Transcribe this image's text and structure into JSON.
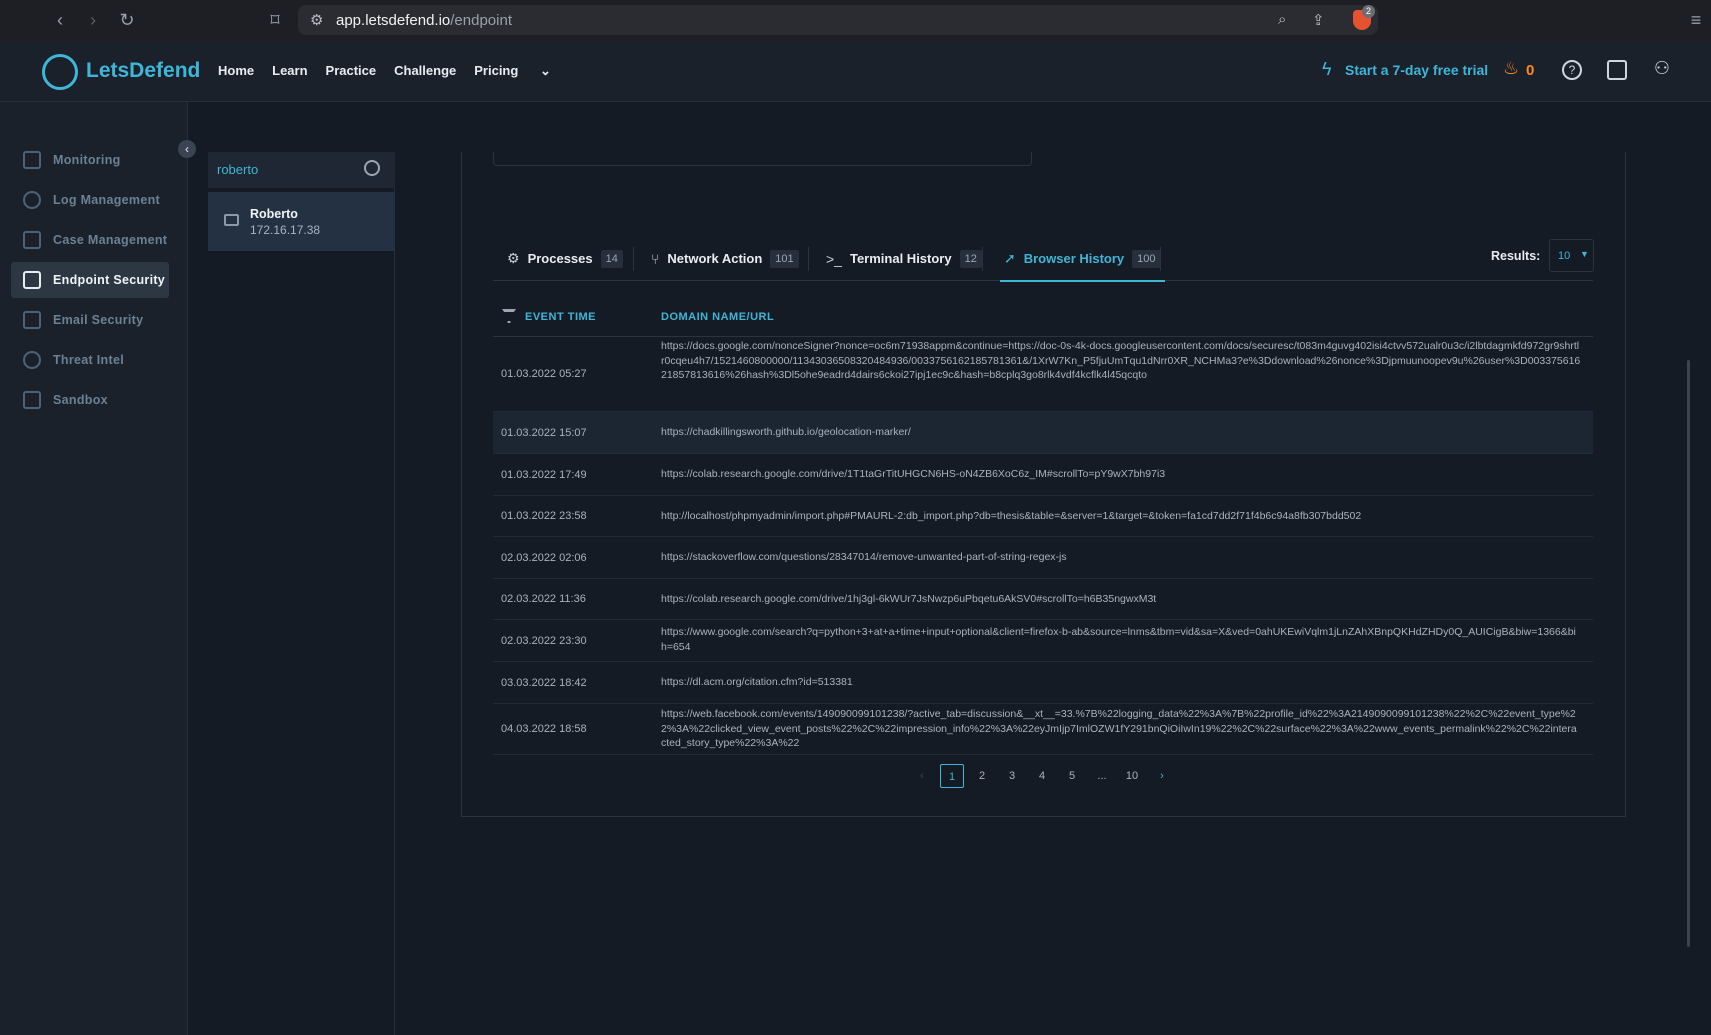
{
  "browser": {
    "url_host": "app.letsdefend.io",
    "url_path": "/endpoint",
    "extension_badge": "2"
  },
  "header": {
    "logo_text": "LetsDefend",
    "nav": [
      "Home",
      "Learn",
      "Practice",
      "Challenge",
      "Pricing"
    ],
    "trial_label": "Start a 7-day free trial",
    "streak_count": "0"
  },
  "sidebar": {
    "items": [
      {
        "label": "Monitoring"
      },
      {
        "label": "Log Management"
      },
      {
        "label": "Case Management"
      },
      {
        "label": "Endpoint Security"
      },
      {
        "label": "Email Security"
      },
      {
        "label": "Threat Intel"
      },
      {
        "label": "Sandbox"
      }
    ],
    "active_index": 3
  },
  "endpoints": {
    "search_value": "roberto",
    "items": [
      {
        "name": "Roberto",
        "ip": "172.16.17.38"
      }
    ]
  },
  "tabs": [
    {
      "label": "Processes",
      "count": "14"
    },
    {
      "label": "Network Action",
      "count": "101"
    },
    {
      "label": "Terminal History",
      "count": "12"
    },
    {
      "label": "Browser History",
      "count": "100"
    }
  ],
  "active_tab": 3,
  "results": {
    "label": "Results:",
    "value": "10"
  },
  "table": {
    "columns": [
      "EVENT TIME",
      "DOMAIN NAME/URL"
    ],
    "rows": [
      {
        "time": "01.03.2022 05:27",
        "url": "https://docs.google.com/nonceSigner?nonce=oc6m71938appm&continue=https://doc-0s-4k-docs.googleusercontent.com/docs/securesc/t083m4guvg402isi4ctvv572ualr0u3c/i2lbtdagmkfd972gr9shrtlr0cqeu4h7/1521460800000/11343036508320484936/0033756162185781361&/1XrW7Kn_P5fjuUmTqu1dNrr0XR_NCHMa3?e%3Ddownload%26nonce%3Djpmuunoopev9u%26user%3D00337561621857813616%26hash%3Dl5ohe9eadrd4dairs6ckoi27ipj1ec9c&hash=b8cplq3go8rlk4vdf4kcflk4l45qcqto"
      },
      {
        "time": "01.03.2022 15:07",
        "url": "https://chadkillingsworth.github.io/geolocation-marker/"
      },
      {
        "time": "01.03.2022 17:49",
        "url": "https://colab.research.google.com/drive/1T1taGrTitUHGCN6HS-oN4ZB6XoC6z_IM#scrollTo=pY9wX7bh97i3"
      },
      {
        "time": "01.03.2022 23:58",
        "url": "http://localhost/phpmyadmin/import.php#PMAURL-2:db_import.php?db=thesis&table=&server=1&target=&token=fa1cd7dd2f71f4b6c94a8fb307bdd502"
      },
      {
        "time": "02.03.2022 02:06",
        "url": "https://stackoverflow.com/questions/28347014/remove-unwanted-part-of-string-regex-js"
      },
      {
        "time": "02.03.2022 11:36",
        "url": "https://colab.research.google.com/drive/1hj3gl-6kWUr7JsNwzp6uPbqetu6AkSV0#scrollTo=h6B35ngwxM3t"
      },
      {
        "time": "02.03.2022 23:30",
        "url": "https://www.google.com/search?q=python+3+at+a+time+input+optional&client=firefox-b-ab&source=lnms&tbm=vid&sa=X&ved=0ahUKEwiVqlm1jLnZAhXBnpQKHdZHDy0Q_AUICigB&biw=1366&bih=654"
      },
      {
        "time": "03.03.2022 18:42",
        "url": "https://dl.acm.org/citation.cfm?id=513381"
      },
      {
        "time": "04.03.2022 18:58",
        "url": "https://web.facebook.com/events/149090099101238/?active_tab=discussion&__xt__=33.%7B%22logging_data%22%3A%7B%22profile_id%22%3A2149090099101238%22%2C%22event_type%22%3A%22clicked_view_event_posts%22%2C%22impression_info%22%3A%22eyJmIjp7ImlOZW1fY291bnQiOiIwIn19%22%2C%22surface%22%3A%22www_events_permalink%22%2C%22interacted_story_type%22%3A%22"
      }
    ]
  },
  "pagination": {
    "pages": [
      "1",
      "2",
      "3",
      "4",
      "5",
      "...",
      "10"
    ],
    "active": "1",
    "prev": "‹",
    "next": "›"
  }
}
